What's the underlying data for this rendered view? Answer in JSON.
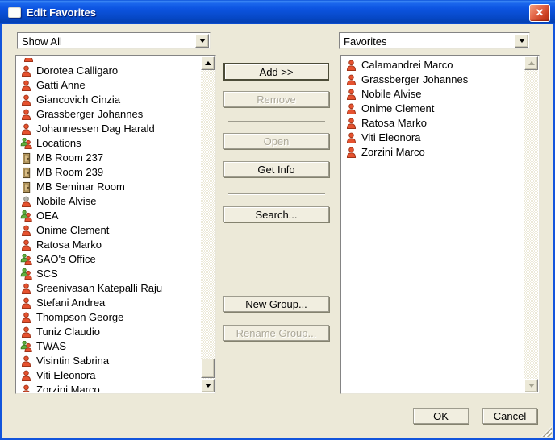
{
  "window": {
    "title": "Edit Favorites"
  },
  "left_panel": {
    "filter_value": "Show All",
    "partial_top_item_icon": "person",
    "items": [
      {
        "label": "Dorotea Calligaro",
        "icon": "person"
      },
      {
        "label": "Gatti Anne",
        "icon": "person"
      },
      {
        "label": "Giancovich Cinzia",
        "icon": "person"
      },
      {
        "label": "Grassberger Johannes",
        "icon": "person"
      },
      {
        "label": "Johannessen Dag Harald",
        "icon": "person"
      },
      {
        "label": "Locations",
        "icon": "group"
      },
      {
        "label": "MB Room 237",
        "icon": "door"
      },
      {
        "label": "MB Room 239",
        "icon": "door"
      },
      {
        "label": "MB Seminar Room",
        "icon": "door"
      },
      {
        "label": "Nobile Alvise",
        "icon": "person-gray"
      },
      {
        "label": "OEA",
        "icon": "group"
      },
      {
        "label": "Onime Clement",
        "icon": "person"
      },
      {
        "label": "Ratosa Marko",
        "icon": "person"
      },
      {
        "label": "SAO's Office",
        "icon": "group"
      },
      {
        "label": "SCS",
        "icon": "group"
      },
      {
        "label": "Sreenivasan Katepalli Raju",
        "icon": "person"
      },
      {
        "label": "Stefani Andrea",
        "icon": "person"
      },
      {
        "label": "Thompson George",
        "icon": "person"
      },
      {
        "label": "Tuniz Claudio",
        "icon": "person"
      },
      {
        "label": "TWAS",
        "icon": "group"
      },
      {
        "label": "Visintin Sabrina",
        "icon": "person"
      },
      {
        "label": "Viti Eleonora",
        "icon": "person"
      },
      {
        "label": "Zorzini Marco",
        "icon": "person"
      }
    ]
  },
  "right_panel": {
    "filter_value": "Favorites",
    "items": [
      {
        "label": "Calamandrei Marco",
        "icon": "person"
      },
      {
        "label": "Grassberger Johannes",
        "icon": "person"
      },
      {
        "label": "Nobile Alvise",
        "icon": "person"
      },
      {
        "label": "Onime Clement",
        "icon": "person"
      },
      {
        "label": "Ratosa Marko",
        "icon": "person"
      },
      {
        "label": "Viti Eleonora",
        "icon": "person"
      },
      {
        "label": "Zorzini Marco",
        "icon": "person"
      }
    ]
  },
  "actions": {
    "add": {
      "label": "Add >>",
      "enabled": true
    },
    "remove": {
      "label": "Remove",
      "enabled": false
    },
    "open": {
      "label": "Open",
      "enabled": false
    },
    "get_info": {
      "label": "Get Info",
      "enabled": true
    },
    "search": {
      "label": "Search...",
      "enabled": true
    },
    "new_group": {
      "label": "New Group...",
      "enabled": true
    },
    "rename_group": {
      "label": "Rename Group...",
      "enabled": false
    }
  },
  "footer": {
    "ok": "OK",
    "cancel": "Cancel"
  },
  "close_glyph": "✕",
  "colors": {
    "titlebar_blue": "#0D52D8",
    "dialog_bg": "#ECE9D8",
    "close_button_red": "#D8472B",
    "person_red": "#E04E2E",
    "person_green": "#5FAE3C",
    "door_brown": "#C9A96E",
    "disabled_text": "#ACA899"
  }
}
